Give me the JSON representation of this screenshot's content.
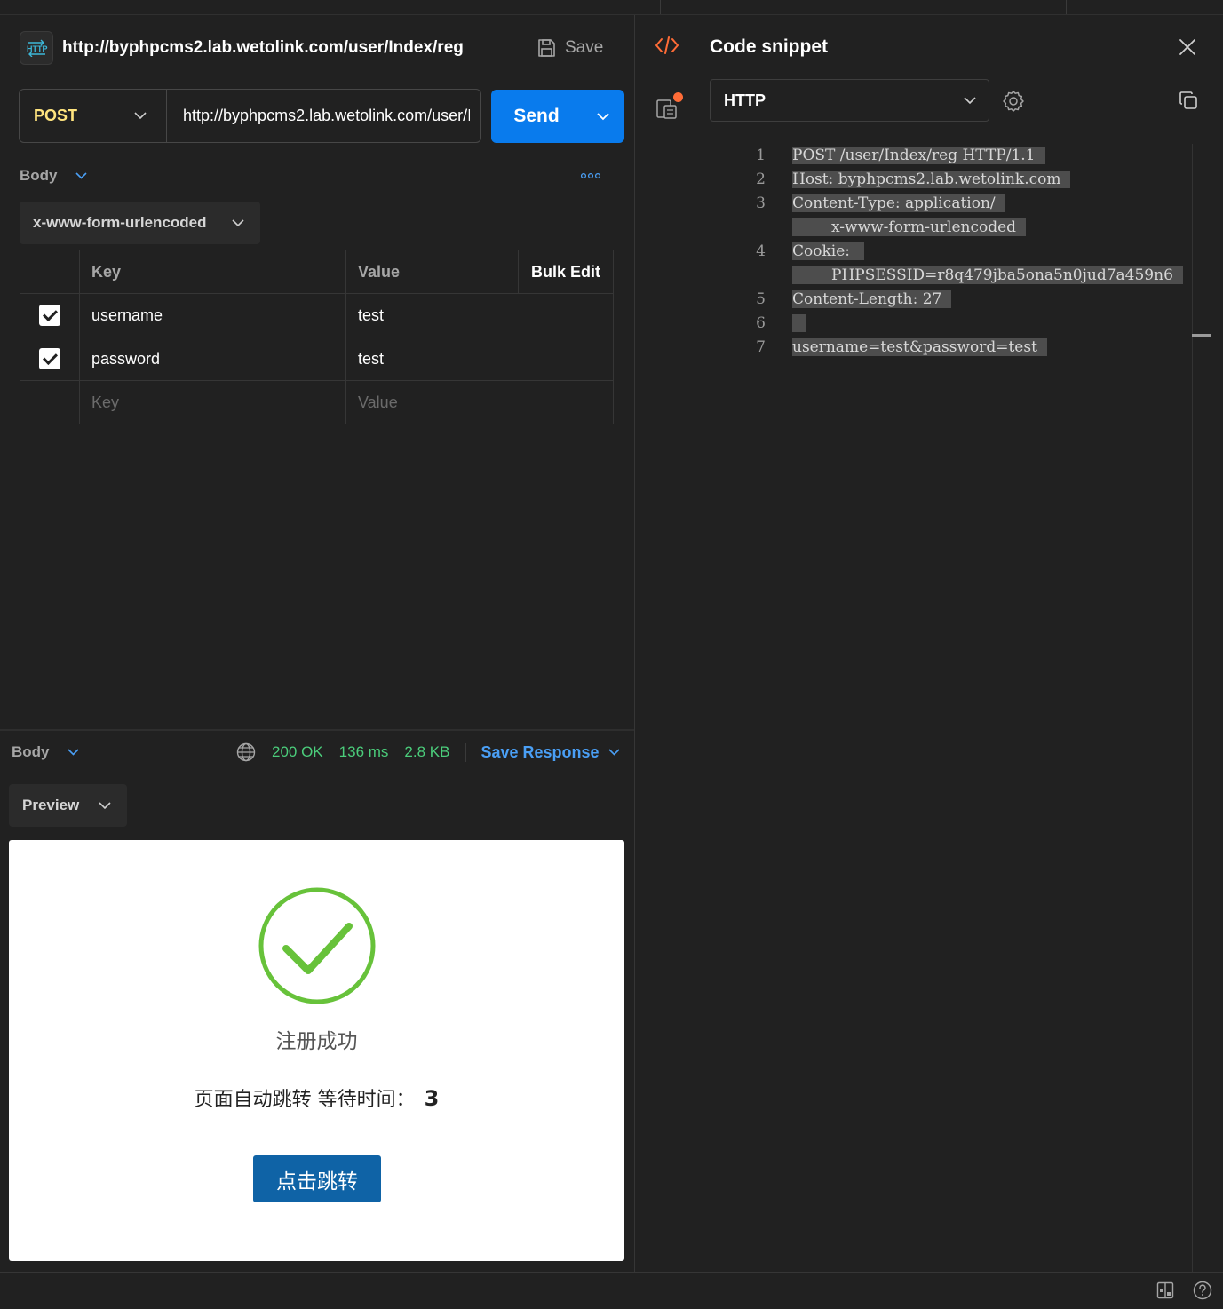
{
  "request": {
    "title": "http://byphpcms2.lab.wetolink.com/user/Index/reg",
    "save_label": "Save",
    "method": "POST",
    "url": "http://byphpcms2.lab.wetolink.com/user/Index/reg",
    "send_label": "Send",
    "body_label": "Body",
    "body_type": "x-www-form-urlencoded",
    "table": {
      "headers": {
        "key": "Key",
        "value": "Value",
        "bulk": "Bulk Edit"
      },
      "rows": [
        {
          "checked": true,
          "key": "username",
          "value": "test"
        },
        {
          "checked": true,
          "key": "password",
          "value": "test"
        }
      ],
      "placeholder": {
        "key": "Key",
        "value": "Value"
      }
    }
  },
  "response": {
    "body_label": "Body",
    "status": "200 OK",
    "time": "136 ms",
    "size": "2.8 KB",
    "save_response_label": "Save Response",
    "view_mode": "Preview",
    "preview": {
      "success_text": "注册成功",
      "wait_text": "页面自动跳转 等待时间：",
      "wait_seconds": "3",
      "jump_button": "点击跳转"
    }
  },
  "snippet": {
    "title": "Code snippet",
    "language": "HTTP",
    "lines": [
      {
        "n": "1",
        "parts": [
          "POST /user/Index/reg HTTP/1.1"
        ]
      },
      {
        "n": "2",
        "parts": [
          "Host: byphpcms2.lab.wetolink.com"
        ]
      },
      {
        "n": "3",
        "parts": [
          "Content-Type: application/",
          "x-www-form-urlencoded"
        ]
      },
      {
        "n": "4",
        "parts": [
          "Cookie: ",
          "PHPSESSID=r8q479jba5ona5n0jud7a459n6"
        ]
      },
      {
        "n": "5",
        "parts": [
          "Content-Length: 27"
        ]
      },
      {
        "n": "6",
        "parts": [
          " "
        ]
      },
      {
        "n": "7",
        "parts": [
          "username=test&password=test"
        ]
      }
    ]
  },
  "colors": {
    "accent_blue": "#097bed",
    "method_post": "#ffe47e",
    "status_green": "#4bcd7b",
    "success_green": "#67c23a",
    "jump_button": "#0f63a6",
    "snippet_icon": "#ff6c37"
  },
  "icons": [
    "http-icon",
    "save-icon",
    "chevron-down-icon",
    "more-icon",
    "globe-icon",
    "code-icon",
    "close-icon",
    "side-panel-icon",
    "gear-icon",
    "copy-icon",
    "check-circle-icon",
    "layout-icon",
    "help-icon"
  ]
}
